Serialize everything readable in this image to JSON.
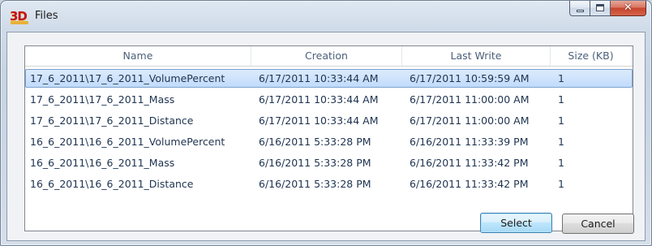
{
  "window": {
    "title": "Files",
    "app_icon_text": "3D",
    "close_glyph": "✕"
  },
  "columns": [
    "Name",
    "Creation",
    "Last Write",
    "Size (KB)"
  ],
  "rows": [
    {
      "name": "17_6_2011\\17_6_2011_VolumePercent",
      "creation": "6/17/2011 10:33:44 AM",
      "last_write": "6/17/2011 10:59:59 AM",
      "size": "1",
      "selected": true
    },
    {
      "name": "17_6_2011\\17_6_2011_Mass",
      "creation": "6/17/2011 10:33:44 AM",
      "last_write": "6/17/2011 11:00:00 AM",
      "size": "1",
      "selected": false
    },
    {
      "name": "17_6_2011\\17_6_2011_Distance",
      "creation": "6/17/2011 10:33:44 AM",
      "last_write": "6/17/2011 11:00:00 AM",
      "size": "1",
      "selected": false
    },
    {
      "name": "16_6_2011\\16_6_2011_VolumePercent",
      "creation": "6/16/2011 5:33:28 PM",
      "last_write": "6/16/2011 11:33:39 PM",
      "size": "1",
      "selected": false
    },
    {
      "name": "16_6_2011\\16_6_2011_Mass",
      "creation": "6/16/2011 5:33:28 PM",
      "last_write": "6/16/2011 11:33:42 PM",
      "size": "1",
      "selected": false
    },
    {
      "name": "16_6_2011\\16_6_2011_Distance",
      "creation": "6/16/2011 5:33:28 PM",
      "last_write": "6/16/2011 11:33:42 PM",
      "size": "1",
      "selected": false
    }
  ],
  "buttons": {
    "select_label": "Select",
    "cancel_label": "Cancel"
  },
  "icons": {
    "app": "3d-app-icon",
    "minimize": "minimize-icon",
    "maximize": "maximize-icon",
    "close": "close-icon"
  },
  "colors": {
    "selection": "#c1dbfc",
    "selection_border": "#7da2ce",
    "close_button": "#c7452d"
  }
}
